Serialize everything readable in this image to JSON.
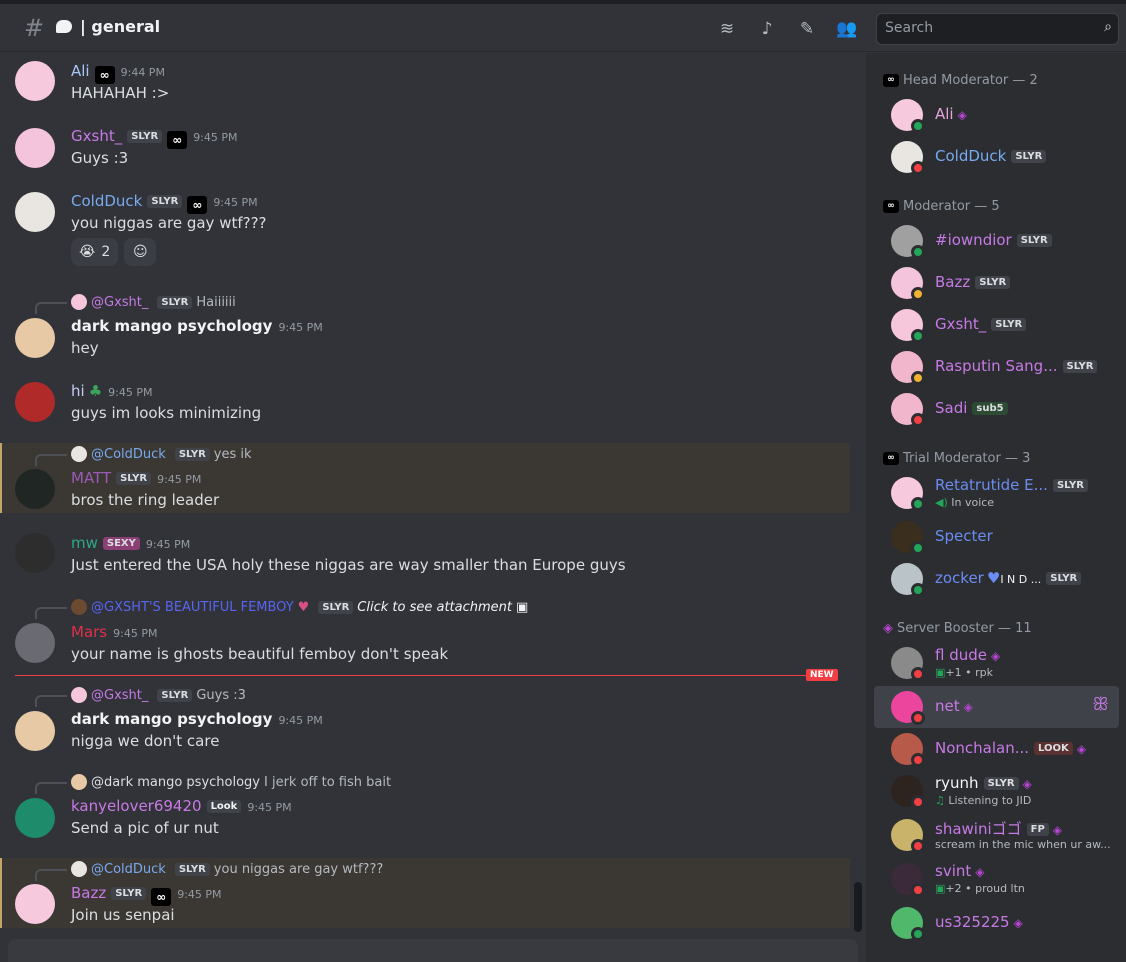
{
  "header": {
    "channel": "| general",
    "search_placeholder": "Search"
  },
  "colors": {
    "accent": "#5865f2",
    "online": "#23a55a",
    "dnd": "#f23f43",
    "idle": "#f0b232",
    "highlight": "#c4a36a"
  },
  "messages": [
    {
      "author": "Ali",
      "time": "9:44 PM",
      "text": "HAHAHAH :>",
      "color": "#a9c7f5"
    },
    {
      "author": "Gxsht_",
      "tag": "SLYR",
      "time": "9:45 PM",
      "text": "Guys :3",
      "color": "#c77ae6"
    },
    {
      "author": "ColdDuck",
      "tag": "SLYR",
      "time": "9:45 PM",
      "text": "you niggas are gay wtf???",
      "color": "#78aaf0",
      "reaction_count": "2"
    },
    {
      "reply_author": "@Gxsht_",
      "reply_tag": "SLYR",
      "reply_text": "Haiiiiii",
      "author": "dark mango psychology",
      "time": "9:45 PM",
      "text": "hey",
      "color": "#f2f3f5"
    },
    {
      "author": "hi",
      "time": "9:45 PM",
      "text": "guys im looks minimizing",
      "color": "#c4c9f5"
    },
    {
      "reply_author": "@ColdDuck",
      "reply_tag": "SLYR",
      "reply_text": "yes ik",
      "author": "MATT",
      "tag": "SLYR",
      "time": "9:45 PM",
      "text": "bros the ring leader",
      "color": "#9b59b6"
    },
    {
      "author": "mw",
      "tag": "SEXY",
      "time": "9:45 PM",
      "text": "Just entered the USA holy these niggas are way smaller than Europe guys",
      "color": "#2ea883"
    },
    {
      "reply_author": "@GXSHT'S BEAUTIFUL FEMBOY",
      "reply_tag": "SLYR",
      "reply_text": "Click to see attachment",
      "author": "Mars",
      "time": "9:45 PM",
      "text": "your name is ghosts beautiful femboy don't speak",
      "color": "#e0304a"
    },
    {
      "reply_author": "@Gxsht_",
      "reply_tag": "SLYR",
      "reply_text": "Guys :3",
      "author": "dark mango psychology",
      "time": "9:45 PM",
      "text": "nigga we don't care",
      "color": "#f2f3f5"
    },
    {
      "reply_author": "@dark mango psychology",
      "reply_text": "I jerk off to fish bait",
      "author": "kanyelover69420",
      "tag": "Look",
      "time": "9:45 PM",
      "text": "Send a pic of ur nut",
      "color": "#c77ae6"
    },
    {
      "reply_author": "@ColdDuck",
      "reply_tag": "SLYR",
      "reply_text": "you niggas are gay wtf???",
      "author": "Bazz",
      "tag": "SLYR",
      "time": "9:45 PM",
      "text": "Join us senpai",
      "color": "#c77ae6"
    }
  ],
  "new_label": "NEW",
  "sections": [
    {
      "title": "Head Moderator — 2"
    },
    {
      "title": "Moderator — 5"
    },
    {
      "title": "Trial Moderator — 3"
    },
    {
      "title": "Server Booster — 11"
    }
  ],
  "members": [
    {
      "name": "Ali",
      "color": "#e5a3d8",
      "status": "online"
    },
    {
      "name": "ColdDuck",
      "tag": "SLYR",
      "color": "#78aaf0",
      "status": "dnd"
    },
    {
      "name": "#iowndior",
      "tag": "SLYR",
      "color": "#c77ae6",
      "status": "online"
    },
    {
      "name": "Bazz",
      "tag": "SLYR",
      "color": "#c77ae6",
      "status": "idle"
    },
    {
      "name": "Gxsht_",
      "tag": "SLYR",
      "color": "#c77ae6",
      "status": "online"
    },
    {
      "name": "Rasputin Sang...",
      "tag": "SLYR",
      "color": "#c77ae6",
      "status": "idle"
    },
    {
      "name": "Sadi",
      "tag": "sub5",
      "color": "#c77ae6",
      "status": "dnd"
    },
    {
      "name": "Retatrutide E...",
      "tag": "SLYR",
      "sub": "In voice",
      "color": "#6b8cf0",
      "status": "online"
    },
    {
      "name": "Specter",
      "color": "#6b8cf0",
      "status": "online"
    },
    {
      "name": "zocker",
      "tag": "SLYR",
      "extra": "I N D ...",
      "color": "#6b8cf0",
      "status": "online"
    },
    {
      "name": "fl dude",
      "sub": "+1 •   rpk",
      "color": "#c77ae6",
      "status": "dnd"
    },
    {
      "name": "net",
      "color": "#c77ae6",
      "status": "dnd"
    },
    {
      "name": "Nonchalan...",
      "tag": "LOOK",
      "color": "#c77ae6",
      "status": "dnd"
    },
    {
      "name": "ryunh",
      "tag": "SLYR",
      "sub": "Listening to JID",
      "color": "#f2f3f5",
      "status": "dnd"
    },
    {
      "name": "shawiniゴゴ",
      "tag": "FP",
      "sub": "scream in the mic when ur aw...",
      "color": "#c77ae6",
      "status": "dnd"
    },
    {
      "name": "svint",
      "sub": "+2 •   proud ltn",
      "color": "#c77ae6",
      "status": "dnd"
    },
    {
      "name": "us325225",
      "color": "#c77ae6",
      "status": "online"
    }
  ]
}
